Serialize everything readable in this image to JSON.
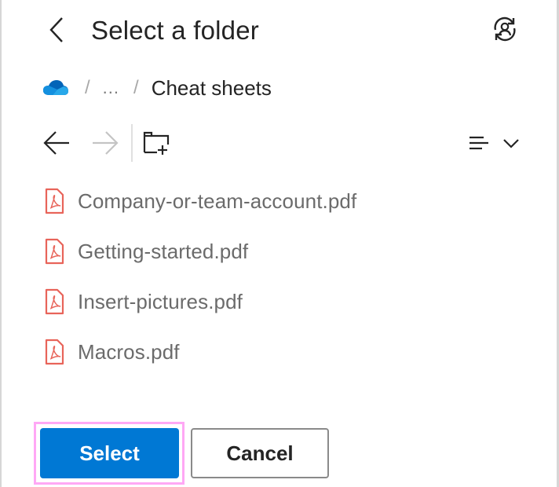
{
  "header": {
    "title": "Select a folder",
    "back_icon": "chevron-left-icon",
    "switch_account_icon": "person-sync-icon"
  },
  "breadcrumb": {
    "root_icon": "onedrive-cloud-icon",
    "separator": "/",
    "ellipsis": "...",
    "current": "Cheat sheets"
  },
  "toolbar": {
    "back_icon": "arrow-left-icon",
    "forward_icon": "arrow-right-icon",
    "forward_disabled": true,
    "new_folder_icon": "folder-add-icon",
    "sort_icon": "text-align-icon",
    "sort_chevron_icon": "chevron-down-icon"
  },
  "files": [
    {
      "name": "Company-or-team-account.pdf",
      "icon": "pdf-file-icon"
    },
    {
      "name": "Getting-started.pdf",
      "icon": "pdf-file-icon"
    },
    {
      "name": "Insert-pictures.pdf",
      "icon": "pdf-file-icon"
    },
    {
      "name": "Macros.pdf",
      "icon": "pdf-file-icon"
    }
  ],
  "footer": {
    "select_label": "Select",
    "cancel_label": "Cancel"
  },
  "colors": {
    "primary": "#0078d4",
    "focus_ring": "#ffa8f5",
    "pdf_icon": "#e8645a",
    "text": "#242424",
    "file_text": "#6b6b6b",
    "disabled_icon": "#c4c4c4"
  }
}
